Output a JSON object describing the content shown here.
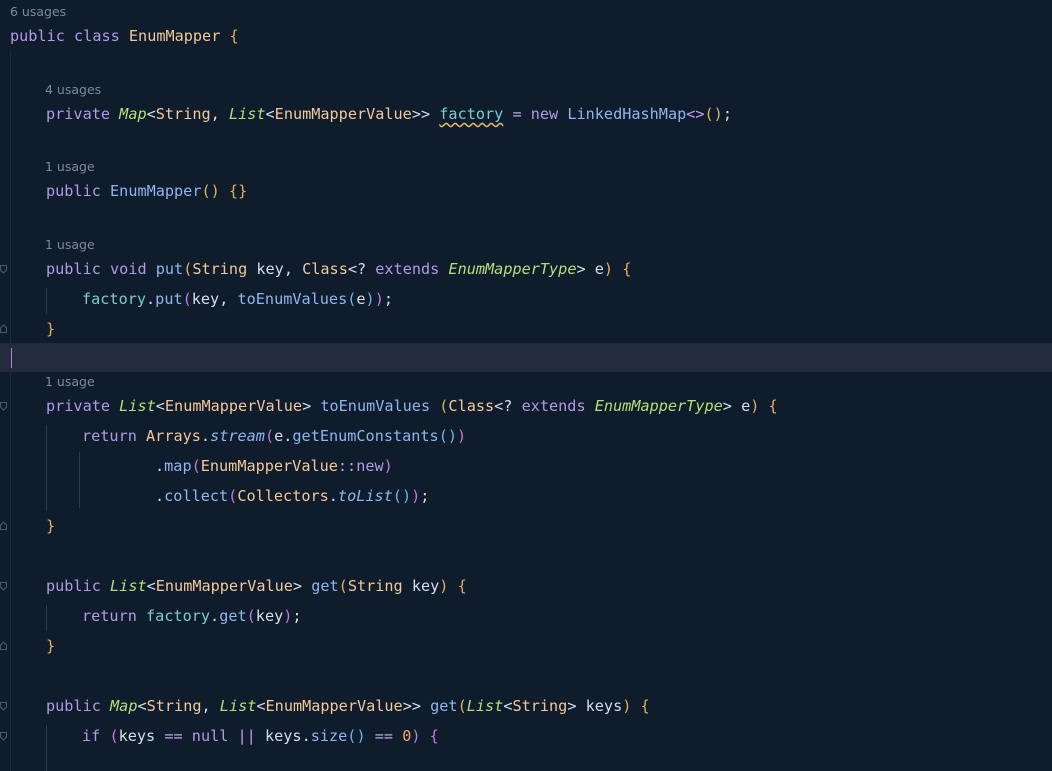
{
  "usage_hints": {
    "class": "6 usages",
    "factory": "4 usages",
    "constructor": "1 usage",
    "put": "1 usage",
    "toEnumValues": "1 usage"
  },
  "tokens": {
    "public": "public",
    "private": "private",
    "class": "class",
    "void": "void",
    "new": "new",
    "return": "return",
    "extends": "extends",
    "if": "if",
    "null": "null",
    "EnumMapper": "EnumMapper",
    "Map": "Map",
    "List": "List",
    "String": "String",
    "Class": "Class",
    "EnumMapperValue": "EnumMapperValue",
    "EnumMapperType": "EnumMapperType",
    "LinkedHashMap": "LinkedHashMap",
    "Arrays": "Arrays",
    "Collectors": "Collectors",
    "factory": "factory",
    "key": "key",
    "keys": "keys",
    "e": "e",
    "put": "put",
    "get": "get",
    "toEnumValues": "toEnumValues",
    "stream": "stream",
    "getEnumConstants": "getEnumConstants",
    "map": "map",
    "collect": "collect",
    "toList": "toList",
    "size": "size",
    "zero": "0"
  },
  "theme": {
    "background": "#0f1c2b",
    "current_line": "#222b3c",
    "caret": "#c678dd",
    "keyword": "#b399e6",
    "class_name": "#f3c89b",
    "interface_name": "#b8de7a",
    "field": "#78cdd2",
    "method": "#8eb6f0"
  }
}
